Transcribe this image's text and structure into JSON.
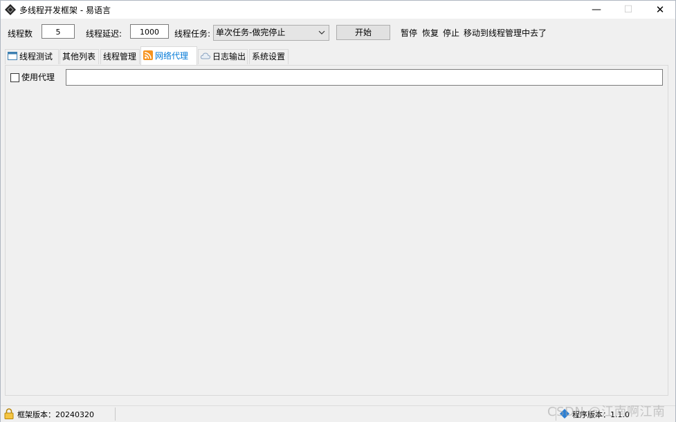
{
  "window": {
    "title": "多线程开发框架 - 易语言",
    "minimize": "—",
    "maximize": "☐",
    "close": "✕"
  },
  "toolbar": {
    "thread_count_label": "线程数",
    "thread_count_value": "5",
    "thread_delay_label": "线程延迟:",
    "thread_delay_value": "1000",
    "thread_task_label": "线程任务:",
    "thread_task_selected": "单次任务-做完停止",
    "start_button": "开始",
    "pause_link": "暂停",
    "resume_link": "恢复",
    "stop_link": "停止",
    "moved_note": "移动到线程管理中去了"
  },
  "tabs": [
    {
      "label": "线程测试",
      "icon": "window-icon"
    },
    {
      "label": "其他列表"
    },
    {
      "label": "线程管理"
    },
    {
      "label": "网络代理",
      "icon": "rss-icon",
      "active": true
    },
    {
      "label": "日志输出",
      "icon": "cloud-icon"
    },
    {
      "label": "系统设置"
    }
  ],
  "proxy": {
    "use_proxy_label": "使用代理",
    "use_proxy_checked": false,
    "proxy_value": ""
  },
  "status": {
    "framework_version": "框架版本：20240320",
    "program_version": "程序版本：1.1.0"
  },
  "watermark": "CSDN @江南啊江南",
  "colors": {
    "accent": "#0078d7",
    "background": "#f0f0f0"
  }
}
